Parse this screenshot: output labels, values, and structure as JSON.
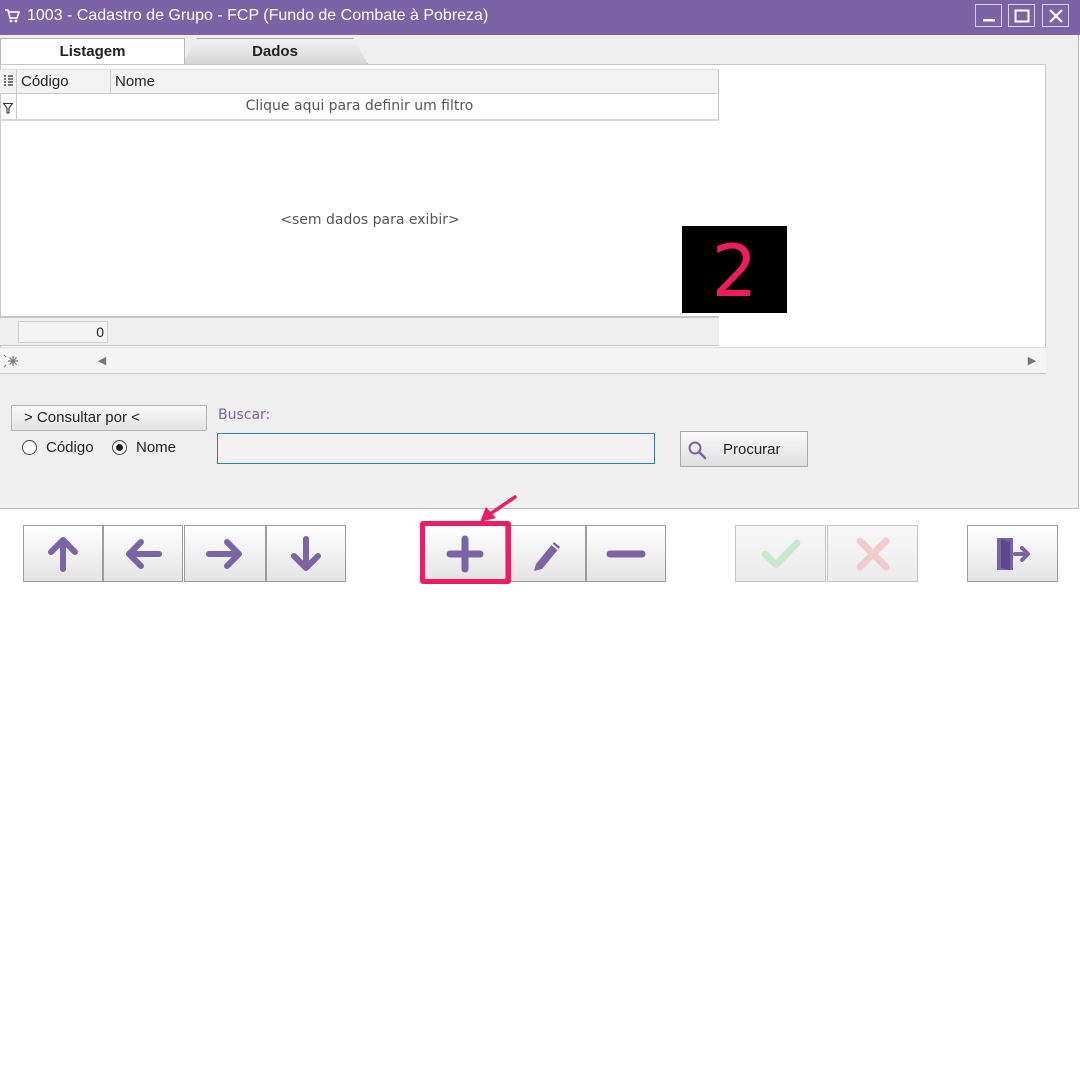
{
  "window": {
    "title": "1003 - Cadastro de Grupo - FCP (Fundo de Combate à Pobreza)",
    "controls": [
      "minimize-icon",
      "maximize-icon",
      "close-icon"
    ]
  },
  "tabs": [
    {
      "label": "Listagem",
      "active": true
    },
    {
      "label": "Dados",
      "active": false
    }
  ],
  "grid": {
    "columns": [
      "Código",
      "Nome"
    ],
    "filter_text": "Clique aqui para definir um filtro",
    "empty_text": "<sem dados para exibir>",
    "count": "0"
  },
  "annotation": {
    "step_number": "2",
    "color": "#ef1b5c"
  },
  "search": {
    "consult_label": "> Consultar por <",
    "options": [
      {
        "label": "Código",
        "selected": false
      },
      {
        "label": "Nome",
        "selected": true
      }
    ],
    "buscar_label": "Buscar:",
    "input_value": "",
    "procurar_label": "Procurar"
  },
  "toolbar": {
    "buttons": [
      "arrow-up-icon",
      "arrow-left-icon",
      "arrow-right-icon",
      "arrow-down-icon",
      "plus-icon",
      "pencil-icon",
      "minus-icon",
      "check-icon",
      "x-icon",
      "exit-door-icon"
    ],
    "highlighted": "plus-icon",
    "disabled": [
      "check-icon",
      "x-icon"
    ]
  },
  "colors": {
    "accent": "#7b63a6",
    "highlight": "#ec1e63"
  }
}
